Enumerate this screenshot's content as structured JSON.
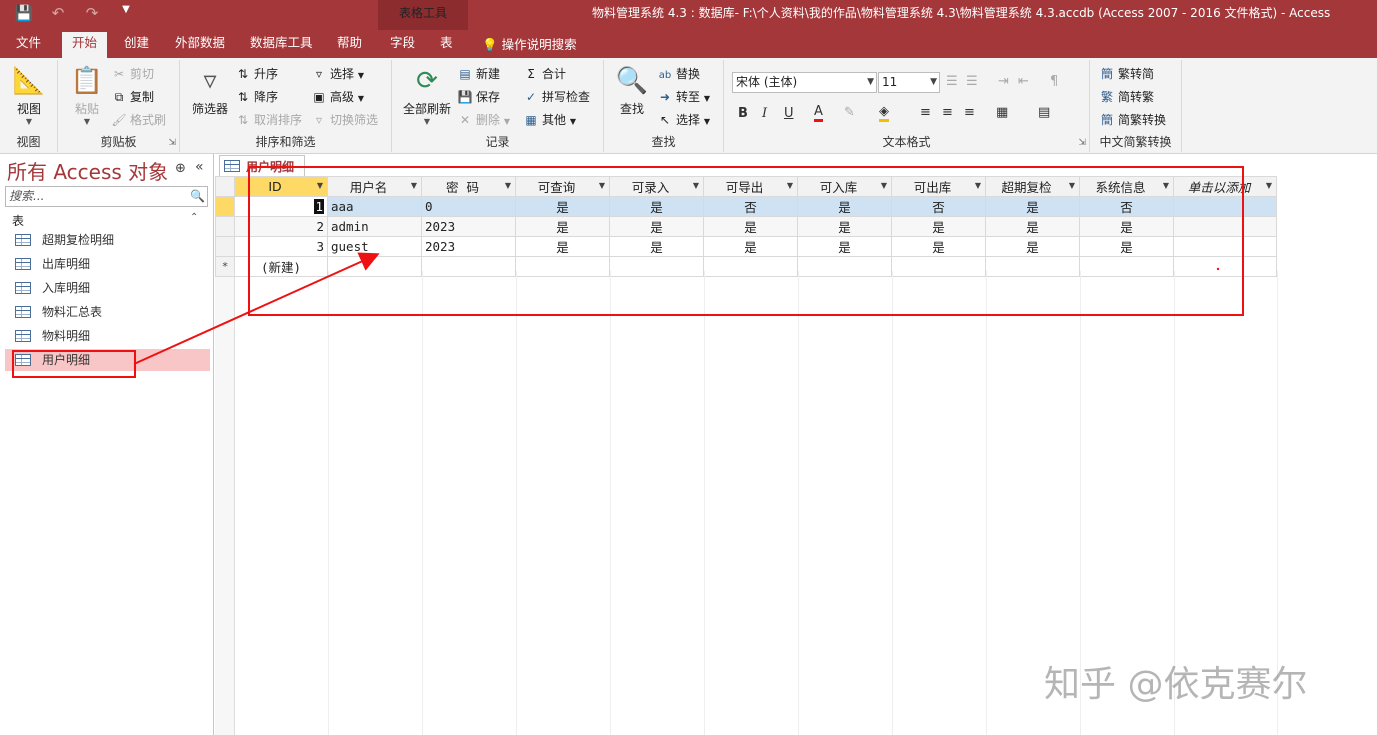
{
  "window": {
    "title": "物料管理系统 4.3 : 数据库- F:\\个人资料\\我的作品\\物料管理系统 4.3\\物料管理系统 4.3.accdb (Access 2007 - 2016 文件格式)  -  Access",
    "context_tab_title": "表格工具"
  },
  "tabs": [
    "文件",
    "开始",
    "创建",
    "外部数据",
    "数据库工具",
    "帮助",
    "字段",
    "表"
  ],
  "active_tab": "开始",
  "tell_me": "操作说明搜索",
  "ribbon": {
    "views": {
      "label": "视图",
      "button": "视图"
    },
    "clipboard": {
      "label": "剪贴板",
      "paste": "粘贴",
      "cut": "剪切",
      "copy": "复制",
      "format_painter": "格式刷"
    },
    "sort_filter": {
      "label": "排序和筛选",
      "filter": "筛选器",
      "ascending": "升序",
      "descending": "降序",
      "remove_sort": "取消排序",
      "selection": "选择",
      "advanced": "高级",
      "toggle_filter": "切换筛选"
    },
    "records": {
      "label": "记录",
      "refresh_all": "全部刷新",
      "new": "新建",
      "save": "保存",
      "delete": "删除",
      "totals": "合计",
      "spelling": "拼写检查",
      "more": "其他"
    },
    "find": {
      "label": "查找",
      "find": "查找",
      "replace": "替换",
      "goto": "转至",
      "select": "选择"
    },
    "text_formatting": {
      "label": "文本格式",
      "font": "宋体 (主体)",
      "size": "11",
      "bold": "B",
      "italic": "I",
      "underline": "U",
      "font_color": "A"
    },
    "chinese_conversion": {
      "label": "中文简繁转换",
      "to_simplified": "繁转简",
      "to_traditional": "简转繁",
      "convert": "简繁转换"
    }
  },
  "nav": {
    "title": "所有 Access 对象",
    "search_placeholder": "搜索...",
    "section": "表",
    "items": [
      "超期复检明细",
      "出库明细",
      "入库明细",
      "物料汇总表",
      "物料明细",
      "用户明细"
    ],
    "selected": "用户明细"
  },
  "document": {
    "tab": "用户明细",
    "columns": [
      "ID",
      "用户名",
      "密  码",
      "可查询",
      "可录入",
      "可导出",
      "可入库",
      "可出库",
      "超期复检",
      "系统信息",
      "单击以添加"
    ],
    "rows": [
      [
        "1",
        "aaa",
        "0",
        "是",
        "是",
        "否",
        "是",
        "否",
        "是",
        "否"
      ],
      [
        "2",
        "admin",
        "2023",
        "是",
        "是",
        "是",
        "是",
        "是",
        "是",
        "是"
      ],
      [
        "3",
        "guest",
        "2023",
        "是",
        "是",
        "是",
        "是",
        "是",
        "是",
        "是"
      ]
    ],
    "new_row_label": "(新建)",
    "new_row_marker": "*"
  },
  "watermark": "知乎 @依克赛尔"
}
